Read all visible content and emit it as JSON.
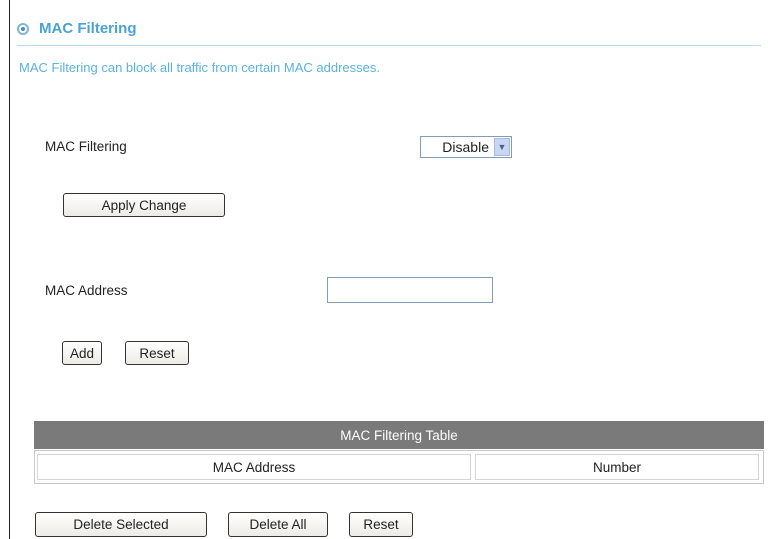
{
  "header": {
    "title": "MAC Filtering",
    "description": "MAC Filtering can block all traffic from certain MAC addresses."
  },
  "filter": {
    "label": "MAC Filtering",
    "select_value": "Disable",
    "apply_label": "Apply Change"
  },
  "address": {
    "label": "MAC Address",
    "input_value": "",
    "add_label": "Add",
    "reset_label": "Reset"
  },
  "table": {
    "title": "MAC Filtering Table",
    "columns": [
      "MAC Address",
      "Number"
    ]
  },
  "actions": {
    "delete_selected_label": "Delete Selected",
    "delete_all_label": "Delete All",
    "reset_label": "Reset"
  }
}
